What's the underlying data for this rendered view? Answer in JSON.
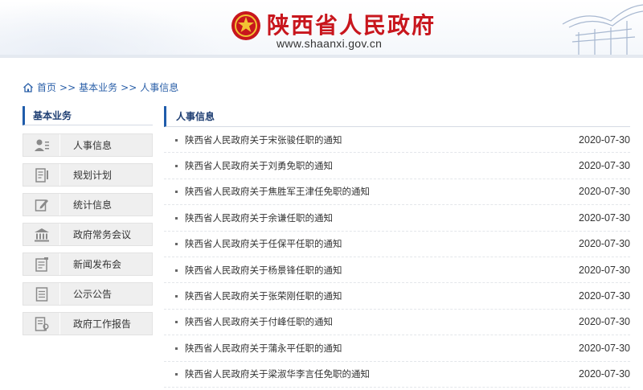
{
  "header": {
    "site_title": "陕西省人民政府",
    "site_url": "www.shaanxi.gov.cn",
    "brand_color": "#c8161d"
  },
  "breadcrumb": {
    "items": [
      "首页",
      "基本业务",
      "人事信息"
    ],
    "separator": ">>"
  },
  "sidebar": {
    "heading": "基本业务",
    "items": [
      {
        "label": "人事信息",
        "icon": "person-card-icon"
      },
      {
        "label": "规划计划",
        "icon": "document-pen-icon"
      },
      {
        "label": "统计信息",
        "icon": "edit-note-icon"
      },
      {
        "label": "政府常务会议",
        "icon": "government-building-icon"
      },
      {
        "label": "新闻发布会",
        "icon": "press-release-icon"
      },
      {
        "label": "公示公告",
        "icon": "notice-list-icon"
      },
      {
        "label": "政府工作报告",
        "icon": "report-seal-icon"
      }
    ]
  },
  "main": {
    "heading": "人事信息",
    "news": [
      {
        "title": "陕西省人民政府关于宋张骏任职的通知",
        "date": "2020-07-30"
      },
      {
        "title": "陕西省人民政府关于刘勇免职的通知",
        "date": "2020-07-30"
      },
      {
        "title": "陕西省人民政府关于焦胜军王津任免职的通知",
        "date": "2020-07-30"
      },
      {
        "title": "陕西省人民政府关于余谦任职的通知",
        "date": "2020-07-30"
      },
      {
        "title": "陕西省人民政府关于任保平任职的通知",
        "date": "2020-07-30"
      },
      {
        "title": "陕西省人民政府关于杨景锋任职的通知",
        "date": "2020-07-30"
      },
      {
        "title": "陕西省人民政府关于张荣刚任职的通知",
        "date": "2020-07-30"
      },
      {
        "title": "陕西省人民政府关于付峰任职的通知",
        "date": "2020-07-30"
      },
      {
        "title": "陕西省人民政府关于蒲永平任职的通知",
        "date": "2020-07-30"
      },
      {
        "title": "陕西省人民政府关于梁淑华李言任免职的通知",
        "date": "2020-07-30"
      }
    ]
  }
}
